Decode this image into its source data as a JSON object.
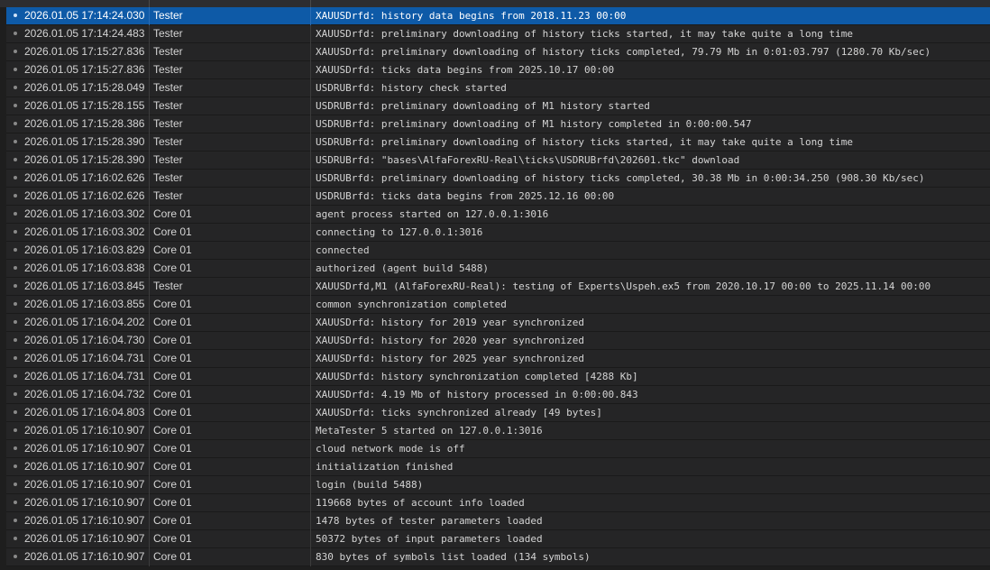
{
  "journal": {
    "rows": [
      {
        "time": "2026.01.05 17:14:24.030",
        "source": "Tester",
        "message": "XAUUSDrfd: history data begins from 2018.11.23 00:00",
        "selected": true
      },
      {
        "time": "2026.01.05 17:14:24.483",
        "source": "Tester",
        "message": "XAUUSDrfd: preliminary downloading of history ticks started, it may take quite a long time"
      },
      {
        "time": "2026.01.05 17:15:27.836",
        "source": "Tester",
        "message": "XAUUSDrfd: preliminary downloading of history ticks completed, 79.79 Mb in 0:01:03.797 (1280.70 Kb/sec)"
      },
      {
        "time": "2026.01.05 17:15:27.836",
        "source": "Tester",
        "message": "XAUUSDrfd: ticks data begins from 2025.10.17 00:00"
      },
      {
        "time": "2026.01.05 17:15:28.049",
        "source": "Tester",
        "message": "USDRUBrfd: history check started"
      },
      {
        "time": "2026.01.05 17:15:28.155",
        "source": "Tester",
        "message": "USDRUBrfd: preliminary downloading of M1 history started"
      },
      {
        "time": "2026.01.05 17:15:28.386",
        "source": "Tester",
        "message": "USDRUBrfd: preliminary downloading of M1 history completed in 0:00:00.547"
      },
      {
        "time": "2026.01.05 17:15:28.390",
        "source": "Tester",
        "message": "USDRUBrfd: preliminary downloading of history ticks started, it may take quite a long time"
      },
      {
        "time": "2026.01.05 17:15:28.390",
        "source": "Tester",
        "message": "USDRUBrfd: \"bases\\AlfaForexRU-Real\\ticks\\USDRUBrfd\\202601.tkc\" download"
      },
      {
        "time": "2026.01.05 17:16:02.626",
        "source": "Tester",
        "message": "USDRUBrfd: preliminary downloading of history ticks completed, 30.38 Mb in 0:00:34.250 (908.30 Kb/sec)"
      },
      {
        "time": "2026.01.05 17:16:02.626",
        "source": "Tester",
        "message": "USDRUBrfd: ticks data begins from 2025.12.16 00:00"
      },
      {
        "time": "2026.01.05 17:16:03.302",
        "source": "Core 01",
        "message": "agent process started on 127.0.0.1:3016"
      },
      {
        "time": "2026.01.05 17:16:03.302",
        "source": "Core 01",
        "message": "connecting to 127.0.0.1:3016"
      },
      {
        "time": "2026.01.05 17:16:03.829",
        "source": "Core 01",
        "message": "connected"
      },
      {
        "time": "2026.01.05 17:16:03.838",
        "source": "Core 01",
        "message": "authorized (agent build 5488)"
      },
      {
        "time": "2026.01.05 17:16:03.845",
        "source": "Tester",
        "message": "XAUUSDrfd,M1 (AlfaForexRU-Real): testing of Experts\\Uspeh.ex5 from 2020.10.17 00:00 to 2025.11.14 00:00"
      },
      {
        "time": "2026.01.05 17:16:03.855",
        "source": "Core 01",
        "message": "common synchronization completed"
      },
      {
        "time": "2026.01.05 17:16:04.202",
        "source": "Core 01",
        "message": "XAUUSDrfd: history for 2019 year synchronized"
      },
      {
        "time": "2026.01.05 17:16:04.730",
        "source": "Core 01",
        "message": "XAUUSDrfd: history for 2020 year synchronized"
      },
      {
        "time": "2026.01.05 17:16:04.731",
        "source": "Core 01",
        "message": "XAUUSDrfd: history for 2025 year synchronized"
      },
      {
        "time": "2026.01.05 17:16:04.731",
        "source": "Core 01",
        "message": "XAUUSDrfd: history synchronization completed [4288 Kb]"
      },
      {
        "time": "2026.01.05 17:16:04.732",
        "source": "Core 01",
        "message": "XAUUSDrfd: 4.19 Mb of history processed in 0:00:00.843"
      },
      {
        "time": "2026.01.05 17:16:04.803",
        "source": "Core 01",
        "message": "XAUUSDrfd: ticks synchronized already [49 bytes]"
      },
      {
        "time": "2026.01.05 17:16:10.907",
        "source": "Core 01",
        "message": "MetaTester 5 started on 127.0.0.1:3016"
      },
      {
        "time": "2026.01.05 17:16:10.907",
        "source": "Core 01",
        "message": "cloud network mode is off"
      },
      {
        "time": "2026.01.05 17:16:10.907",
        "source": "Core 01",
        "message": "initialization finished"
      },
      {
        "time": "2026.01.05 17:16:10.907",
        "source": "Core 01",
        "message": "login (build 5488)"
      },
      {
        "time": "2026.01.05 17:16:10.907",
        "source": "Core 01",
        "message": "119668 bytes of account info loaded"
      },
      {
        "time": "2026.01.05 17:16:10.907",
        "source": "Core 01",
        "message": "1478 bytes of tester parameters loaded"
      },
      {
        "time": "2026.01.05 17:16:10.907",
        "source": "Core 01",
        "message": "50372 bytes of input parameters loaded"
      },
      {
        "time": "2026.01.05 17:16:10.907",
        "source": "Core 01",
        "message": "830 bytes of symbols list loaded (134 symbols)"
      }
    ]
  },
  "colors": {
    "background": "#1e1e1e",
    "row_background": "#252526",
    "selected_row": "#0e5aa7",
    "text": "#d4d4d4",
    "bullet": "#8a8a8a"
  },
  "icons": {
    "row_marker": "bullet-dot-icon"
  }
}
